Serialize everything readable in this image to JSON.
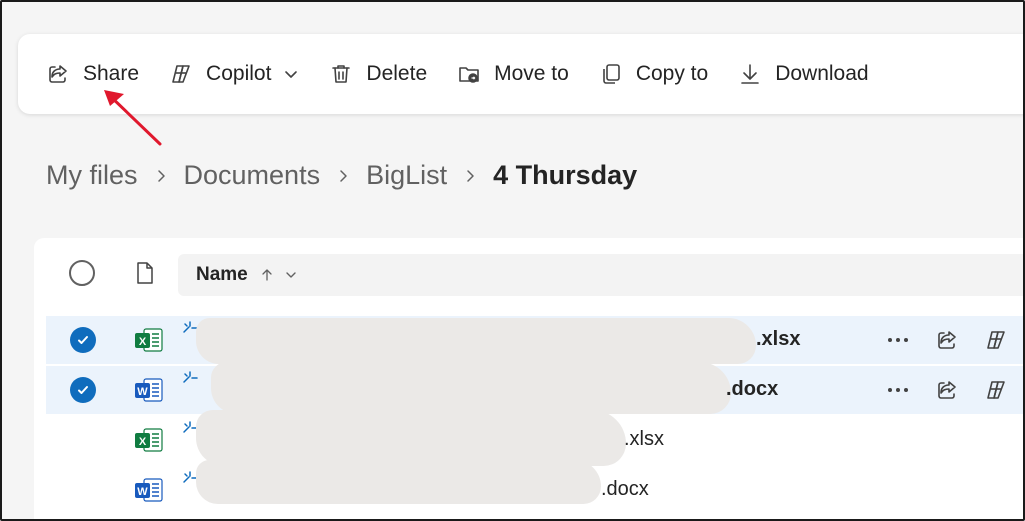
{
  "toolbar": {
    "share_label": "Share",
    "copilot_label": "Copilot",
    "delete_label": "Delete",
    "move_label": "Move to",
    "copy_label": "Copy to",
    "download_label": "Download"
  },
  "breadcrumb": [
    "My files",
    "Documents",
    "BigList",
    "4 Thursday"
  ],
  "list": {
    "name_header": "Name",
    "files": [
      {
        "name_visible": ".xlsx",
        "type": "excel",
        "selected": true
      },
      {
        "name_visible": ".docx",
        "type": "word",
        "selected": true
      },
      {
        "name_visible": ".xlsx",
        "type": "excel",
        "selected": false
      },
      {
        "name_visible": ".docx",
        "type": "word",
        "selected": false
      }
    ]
  },
  "colors": {
    "accent": "#0f6cbd",
    "selected_row": "#ebf3fc",
    "annotation_arrow": "#e0182d",
    "excel": "#107c41",
    "word": "#185abd"
  }
}
